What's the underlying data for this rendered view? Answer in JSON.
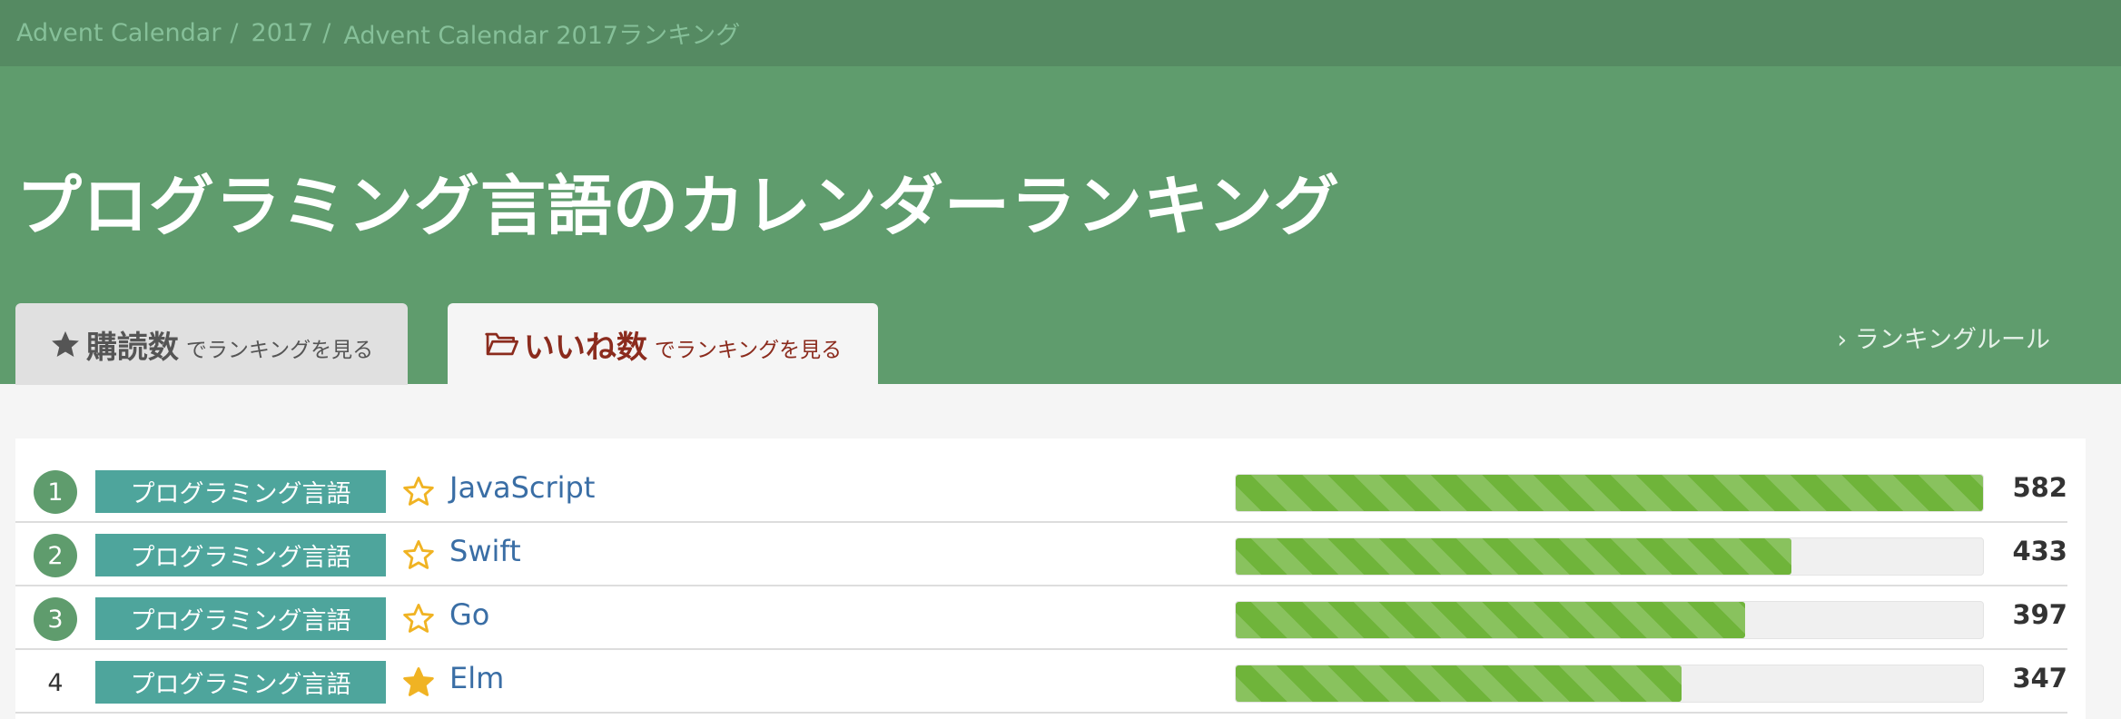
{
  "breadcrumb": {
    "items": [
      "Advent Calendar",
      "2017",
      "Advent Calendar 2017ランキング"
    ],
    "separator": "/"
  },
  "header": {
    "title": "プログラミング言語のカレンダーランキング",
    "colors": {
      "bar": "#558a62",
      "band": "#5f9c6d"
    }
  },
  "tabs": [
    {
      "big": "購読数",
      "small": "でランキングを見る",
      "icon": "star-icon",
      "active": false
    },
    {
      "big": "いいね数",
      "small": "でランキングを見る",
      "icon": "folder-open-icon",
      "active": true
    }
  ],
  "rules_link": "› ランキングルール",
  "ranking": {
    "max_value": 582,
    "rows": [
      {
        "rank": "1",
        "category": "プログラミング言語",
        "name": "JavaScript",
        "count": 582,
        "starred": false,
        "rank_badge": true
      },
      {
        "rank": "2",
        "category": "プログラミング言語",
        "name": "Swift",
        "count": 433,
        "starred": false,
        "rank_badge": true
      },
      {
        "rank": "3",
        "category": "プログラミング言語",
        "name": "Go",
        "count": 397,
        "starred": false,
        "rank_badge": true
      },
      {
        "rank": "4",
        "category": "プログラミング言語",
        "name": "Elm",
        "count": 347,
        "starred": true,
        "rank_badge": false
      }
    ],
    "colors": {
      "badge": "#4ea59c",
      "bar": "#6fb43a",
      "star": "#f0b323",
      "link": "#3a6ea5"
    }
  }
}
